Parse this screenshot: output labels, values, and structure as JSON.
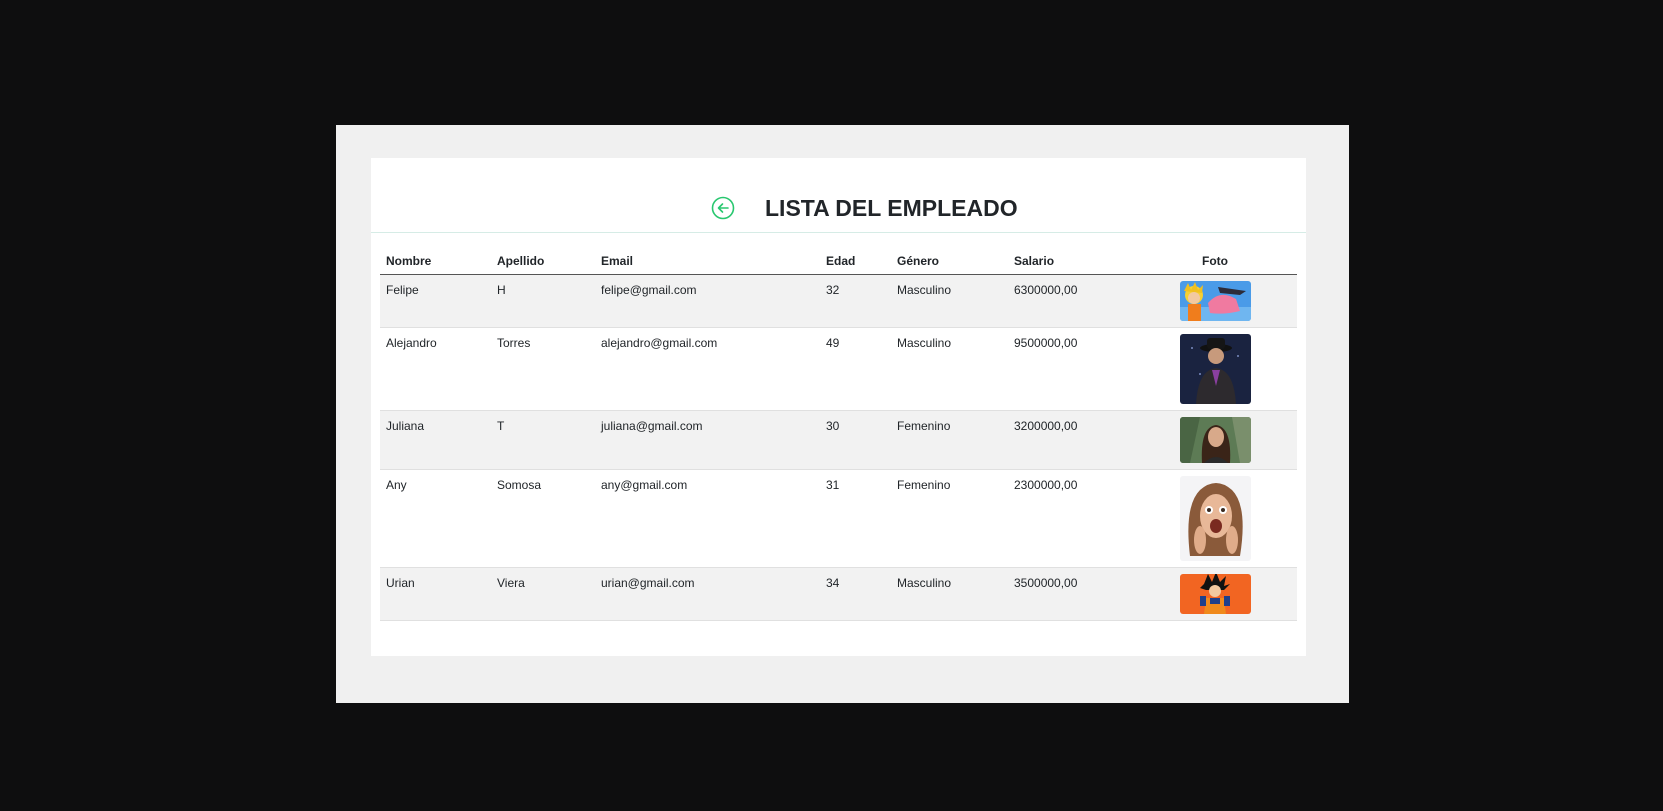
{
  "header": {
    "title": "LISTA DEL EMPLEADO",
    "back_icon": "arrow-left-circle-icon",
    "accent": "#28c76f"
  },
  "table": {
    "columns": [
      "Nombre",
      "Apellido",
      "Email",
      "Edad",
      "Género",
      "Salario",
      "Foto"
    ],
    "rows": [
      {
        "nombre": "Felipe",
        "apellido": "H",
        "email": "felipe@gmail.com",
        "edad": "32",
        "genero": "Masculino",
        "salario": "6300000,00",
        "foto": "anime-character-photo"
      },
      {
        "nombre": "Alejandro",
        "apellido": "Torres",
        "email": "alejandro@gmail.com",
        "edad": "49",
        "genero": "Masculino",
        "salario": "9500000,00",
        "foto": "man-in-hat-photo"
      },
      {
        "nombre": "Juliana",
        "apellido": "T",
        "email": "juliana@gmail.com",
        "edad": "30",
        "genero": "Femenino",
        "salario": "3200000,00",
        "foto": "woman-portrait-photo"
      },
      {
        "nombre": "Any",
        "apellido": "Somosa",
        "email": "any@gmail.com",
        "edad": "31",
        "genero": "Femenino",
        "salario": "2300000,00",
        "foto": "surprised-woman-photo"
      },
      {
        "nombre": "Urian",
        "apellido": "Viera",
        "email": "urian@gmail.com",
        "edad": "34",
        "genero": "Masculino",
        "salario": "3500000,00",
        "foto": "anime-fighter-photo"
      }
    ]
  }
}
